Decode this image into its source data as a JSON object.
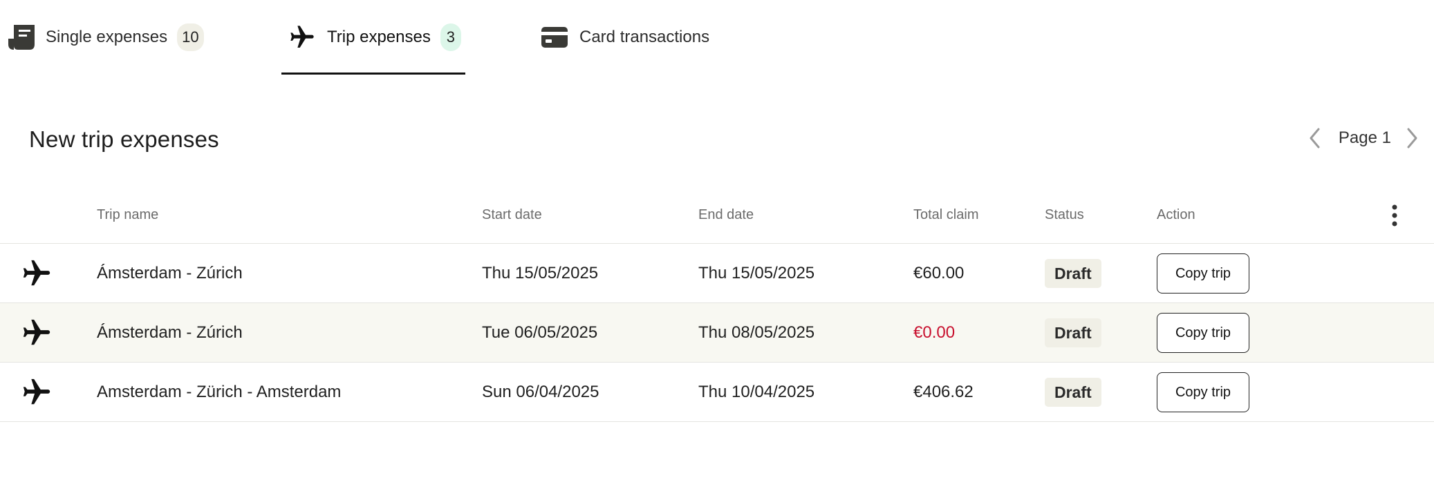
{
  "tabs": [
    {
      "label": "Single expenses",
      "count": "10",
      "icon": "receipt-icon"
    },
    {
      "label": "Trip expenses",
      "count": "3",
      "icon": "airplane-icon",
      "active": true
    },
    {
      "label": "Card transactions",
      "icon": "credit-card-icon"
    }
  ],
  "section": {
    "title": "New trip expenses"
  },
  "pager": {
    "label": "Page 1",
    "prev_icon": "chevron-left-icon",
    "next_icon": "chevron-right-icon"
  },
  "table": {
    "headers": {
      "trip_name": "Trip name",
      "start_date": "Start date",
      "end_date": "End date",
      "total_claim": "Total claim",
      "status": "Status",
      "action": "Action"
    },
    "menu_icon": "more-vertical-icon",
    "rows": [
      {
        "name": "Ámsterdam - Zúrich",
        "start": "Thu 15/05/2025",
        "end": "Thu 15/05/2025",
        "claim": "€60.00",
        "status": "Draft",
        "action": "Copy trip"
      },
      {
        "name": "Ámsterdam - Zúrich",
        "start": "Tue 06/05/2025",
        "end": "Thu 08/05/2025",
        "claim": "€0.00",
        "status": "Draft",
        "action": "Copy trip"
      },
      {
        "name": "Amsterdam - Zürich - Amsterdam",
        "start": "Sun 06/04/2025",
        "end": "Thu 10/04/2025",
        "claim": "€406.62",
        "status": "Draft",
        "action": "Copy trip"
      }
    ]
  },
  "colors": {
    "accent": "#111111",
    "zero_claim": "#c8102e",
    "badge_bg": "#f0efe6",
    "active_badge_bg": "#dcf6e9",
    "alt_row_bg": "#f8f8f2"
  }
}
